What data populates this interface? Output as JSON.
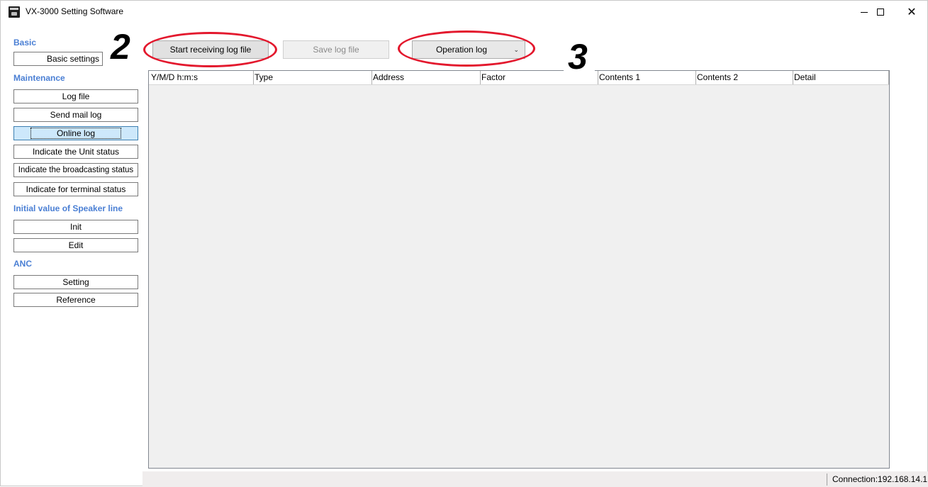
{
  "window": {
    "title": "VX-3000 Setting Software",
    "controls": {
      "minimize": "—",
      "maximize": "☐",
      "close": "✕"
    }
  },
  "sidebar": {
    "basic_header": "Basic",
    "basic_settings": "Basic settings",
    "maintenance_header": "Maintenance",
    "maintenance_items": [
      "Log file",
      "Send mail log",
      "Online log",
      "Indicate the Unit status",
      "Indicate the broadcasting status",
      "Indicate for terminal status"
    ],
    "speaker_header": "Initial value of Speaker line",
    "speaker_items": [
      "Init",
      "Edit"
    ],
    "anc_header": "ANC",
    "anc_items": [
      "Setting",
      "Reference"
    ]
  },
  "toolbar": {
    "start_label": "Start receiving log file",
    "save_label": "Save log file",
    "log_type_selected": "Operation log",
    "chevron_icon": "chevron-down-icon"
  },
  "annotations": {
    "step_2": "2",
    "step_3": "3",
    "ellipse_color": "#e3182d"
  },
  "table": {
    "columns": [
      "Y/M/D h:m:s",
      "Type",
      "Address",
      "Factor",
      "Contents 1",
      "Contents 2",
      "Detail"
    ],
    "rows": []
  },
  "status": {
    "connection": "Connection:192.168.14.1"
  },
  "colors": {
    "section_header": "#4a7fd4",
    "selected_item_bg": "#cde8fb"
  }
}
